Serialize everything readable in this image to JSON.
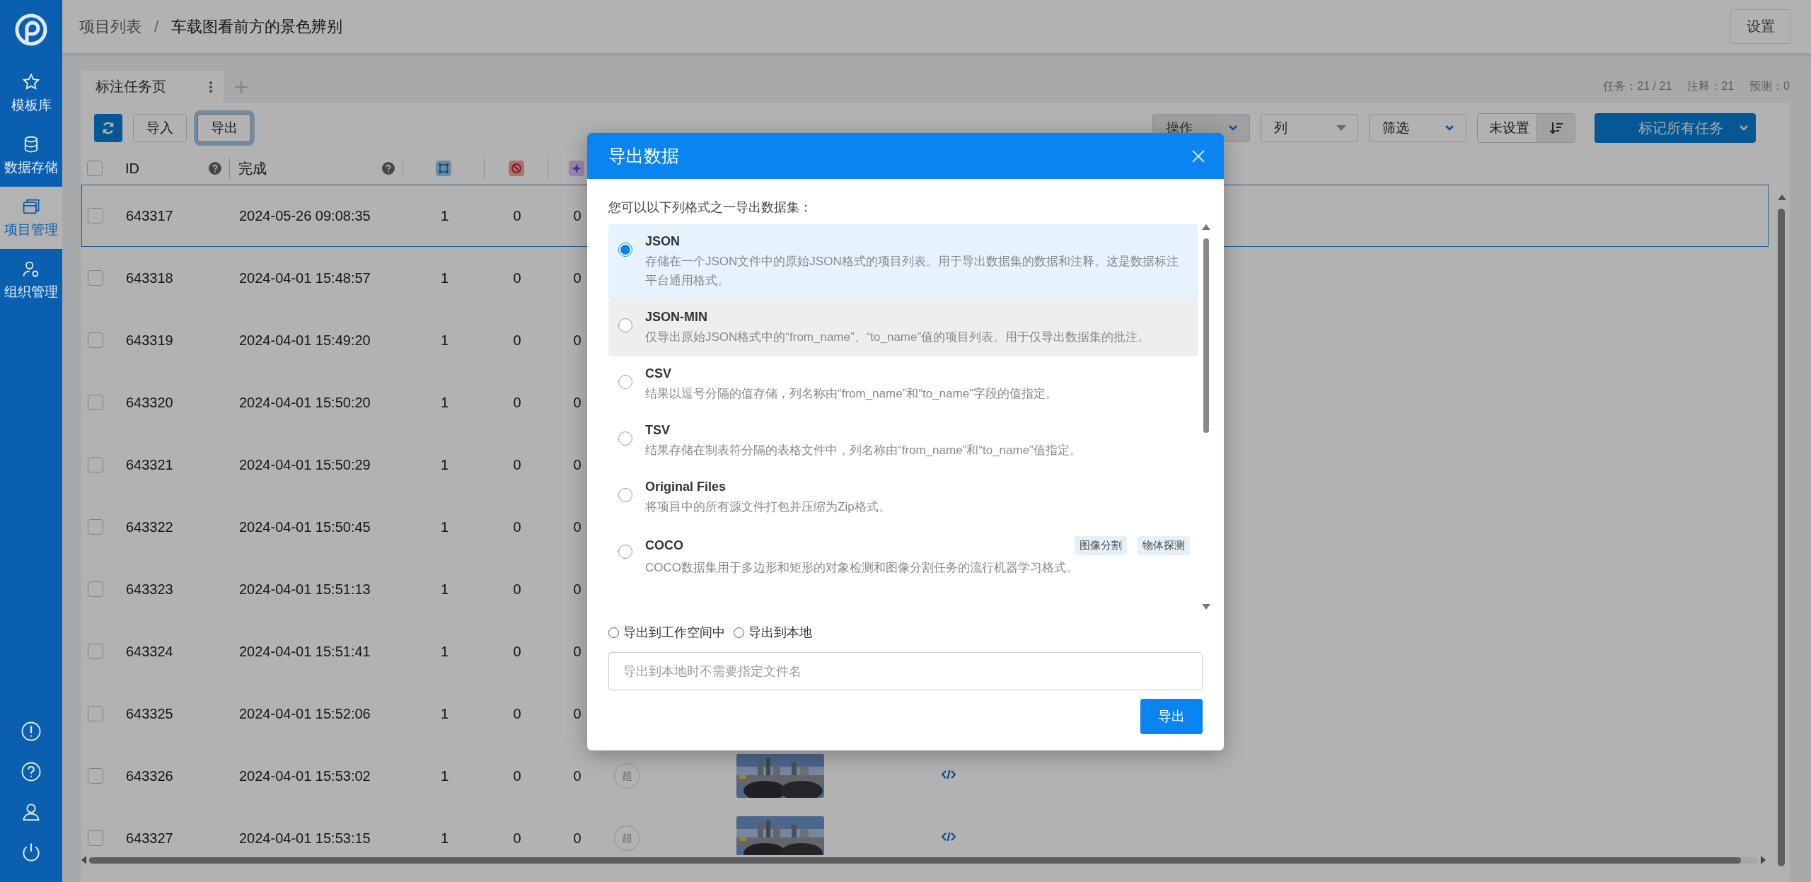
{
  "sidebar": {
    "items": [
      {
        "label": "模板库",
        "selected": false
      },
      {
        "label": "数据存储",
        "selected": false
      },
      {
        "label": "项目管理",
        "selected": true
      },
      {
        "label": "组织管理",
        "selected": false
      }
    ]
  },
  "breadcrumb": {
    "items": [
      "项目列表",
      "车载图看前方的景色辨别"
    ],
    "separator": "/"
  },
  "settings_button": "设置",
  "tabs": [
    {
      "label": "标注任务页",
      "selected": true
    }
  ],
  "stats": [
    "任务：21 / 21",
    "注释：21",
    "预测：0"
  ],
  "toolbar": {
    "buttons": [
      {
        "label": "导入",
        "focused": false
      },
      {
        "label": "导出",
        "focused": true
      }
    ],
    "dropdowns": [
      {
        "label": "操作",
        "kind": "menu",
        "disabled": true
      },
      {
        "label": "列",
        "kind": "select",
        "disabled": false
      },
      {
        "label": "筛选",
        "kind": "menu",
        "disabled": false
      }
    ],
    "sort": "未设置",
    "primary": "标记所有任务"
  },
  "table": {
    "select_all": {
      "checked": false
    },
    "columns": [
      "ID",
      "完成"
    ],
    "rows": [
      {
        "checked": false,
        "selected": true,
        "id": "643317",
        "completed": "2024-05-26 09:08:35",
        "cells": [
          "1",
          "0",
          "0"
        ]
      },
      {
        "checked": false,
        "selected": false,
        "id": "643318",
        "completed": "2024-04-01 15:48:57",
        "cells": [
          "1",
          "0",
          "0"
        ]
      },
      {
        "checked": false,
        "selected": false,
        "id": "643319",
        "completed": "2024-04-01 15:49:20",
        "cells": [
          "1",
          "0",
          "0"
        ]
      },
      {
        "checked": false,
        "selected": false,
        "id": "643320",
        "completed": "2024-04-01 15:50:20",
        "cells": [
          "1",
          "0",
          "0"
        ]
      },
      {
        "checked": false,
        "selected": false,
        "id": "643321",
        "completed": "2024-04-01 15:50:29",
        "cells": [
          "1",
          "0",
          "0"
        ]
      },
      {
        "checked": false,
        "selected": false,
        "id": "643322",
        "completed": "2024-04-01 15:50:45",
        "cells": [
          "1",
          "0",
          "0"
        ]
      },
      {
        "checked": false,
        "selected": false,
        "id": "643323",
        "completed": "2024-04-01 15:51:13",
        "cells": [
          "1",
          "0",
          "0"
        ]
      },
      {
        "checked": false,
        "selected": false,
        "id": "643324",
        "completed": "2024-04-01 15:51:41",
        "cells": [
          "1",
          "0",
          "0"
        ]
      },
      {
        "checked": false,
        "selected": false,
        "id": "643325",
        "completed": "2024-04-01 15:52:06",
        "cells": [
          "1",
          "0",
          "0"
        ]
      },
      {
        "checked": false,
        "selected": false,
        "id": "643326",
        "completed": "2024-04-01 15:53:02",
        "cells": [
          "1",
          "0",
          "0"
        ],
        "badge": "超",
        "preview": {
          "kind": "picture"
        }
      },
      {
        "checked": false,
        "selected": false,
        "id": "643327",
        "completed": "2024-04-01 15:53:15",
        "cells": [
          "1",
          "0",
          "0"
        ],
        "badge": "超",
        "preview": {
          "kind": "picture"
        }
      }
    ]
  },
  "modal": {
    "title": "导出数据",
    "intro": "您可以以下列格式之一导出数据集：",
    "formats": [
      {
        "name": "JSON",
        "description": "存储在一个JSON文件中的原始JSON格式的项目列表。用于导出数据集的数据和注释。这是数据标注平台通用格式。",
        "selected": true,
        "hovered": false
      },
      {
        "name": "JSON-MIN",
        "description": "仅导出原始JSON格式中的“from_name”、“to_name”值的项目列表。用于仅导出数据集的批注。",
        "selected": false,
        "hovered": true
      },
      {
        "name": "CSV",
        "description": "结果以逗号分隔的值存储，列名称由“from_name”和“to_name”字段的值指定。",
        "selected": false,
        "hovered": false
      },
      {
        "name": "TSV",
        "description": "结果存储在制表符分隔的表格文件中，列名称由“from_name”和“to_name”值指定。",
        "selected": false,
        "hovered": false
      },
      {
        "name": "Original Files",
        "description": "将项目中的所有源文件打包并压缩为Zip格式。",
        "selected": false,
        "hovered": false
      },
      {
        "name": "COCO",
        "description": "COCO数据集用于多边形和矩形的对象检测和图像分割任务的流行机器学习格式。",
        "tags": [
          "图像分割",
          "物体探测"
        ],
        "selected": false,
        "hovered": false
      }
    ],
    "destinations": [
      {
        "label": "导出到工作空间中",
        "selected": false
      },
      {
        "label": "导出到本地",
        "selected": false
      }
    ],
    "filename_placeholder": "导出到本地时不需要指定文件名",
    "submit": "导出"
  }
}
